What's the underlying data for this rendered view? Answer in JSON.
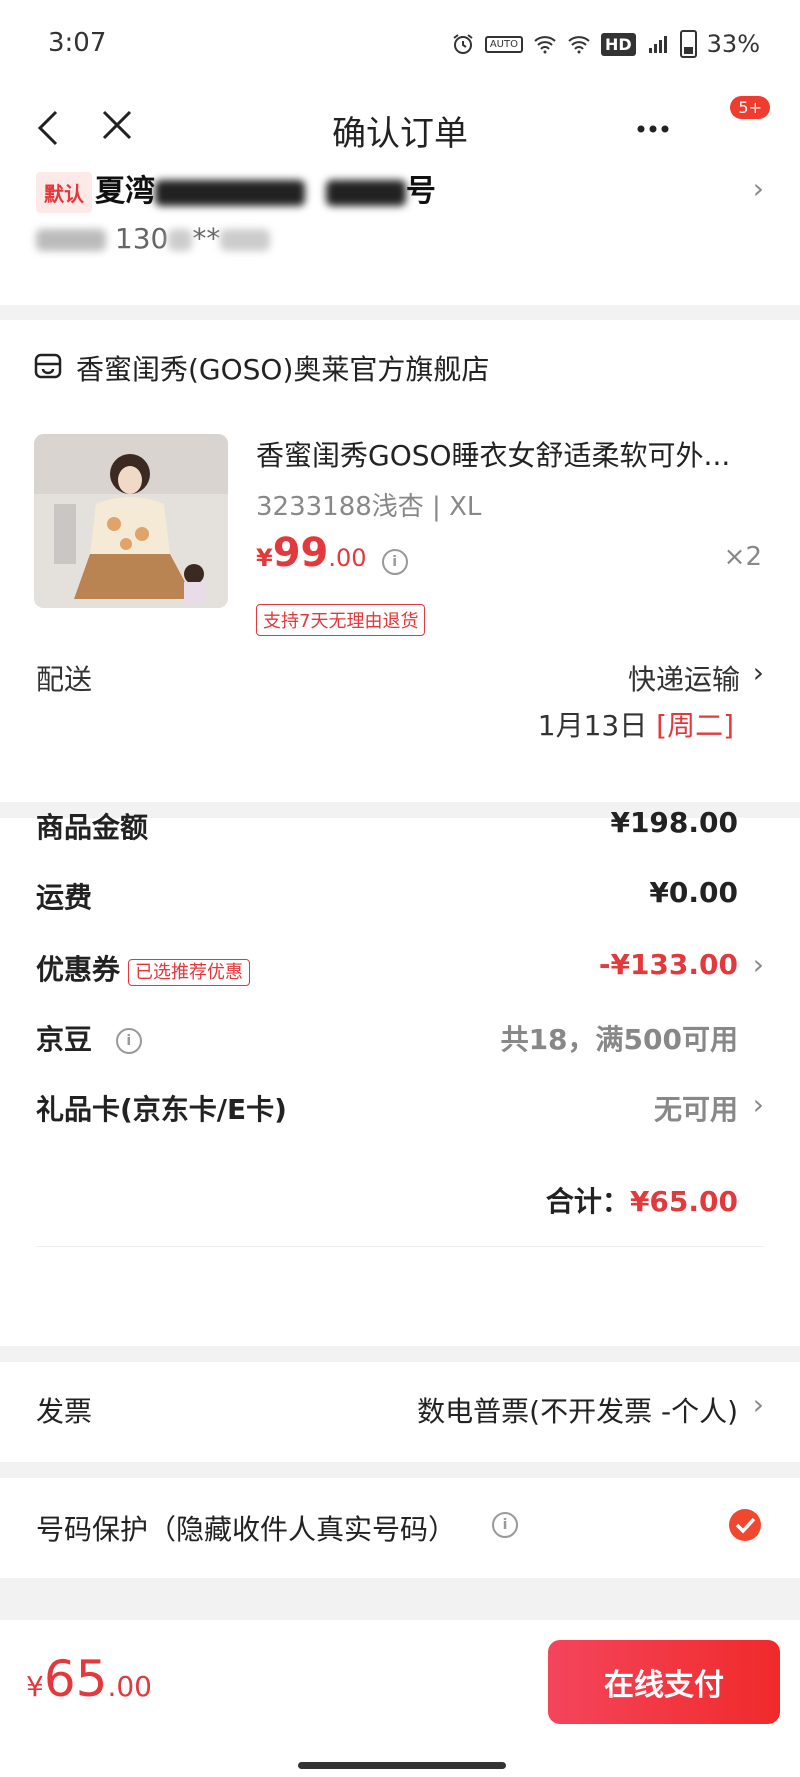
{
  "status_bar": {
    "time": "3:07",
    "battery": "33%",
    "hd": "HD",
    "auto": "AUTO"
  },
  "nav": {
    "title": "确认订单",
    "more_badge": "5+"
  },
  "address": {
    "default_tag": "默认",
    "name_line_prefix": "夏湾",
    "name_line_suffix": "号",
    "phone_partial": "130",
    "phone_masked": "**"
  },
  "shop": {
    "name": "香蜜闺秀(GOSO)奥莱官方旗舰店",
    "product": {
      "title": "香蜜闺秀GOSO睡衣女舒适柔软可外...",
      "spec": "3233188浅杏 | XL",
      "price_currency": "¥",
      "price_int": "99",
      "price_dec": ".00",
      "quantity": "×2",
      "return_tag": "支持7天无理由退货"
    },
    "delivery": {
      "label": "配送",
      "method": "快递运输",
      "date": "1月13日",
      "weekday": "[周二]"
    }
  },
  "summary": {
    "goods_amount": {
      "label": "商品金额",
      "value": "¥198.00"
    },
    "shipping": {
      "label": "运费",
      "value": "¥0.00"
    },
    "coupon": {
      "label": "优惠券",
      "tag": "已选推荐优惠",
      "value": "-¥133.00"
    },
    "jd_beans": {
      "label": "京豆",
      "value": "共18，满500可用"
    },
    "gift_card": {
      "label": "礼品卡(京东卡/E卡)",
      "value": "无可用"
    },
    "total": {
      "label": "合计：",
      "value": "¥65.00"
    }
  },
  "invoice": {
    "label": "发票",
    "value": "数电普票(不开发票 -个人)"
  },
  "number_protect": {
    "label": "号码保护（隐藏收件人真实号码）",
    "checked": true
  },
  "bottom": {
    "currency": "¥",
    "amount_int": "65",
    "amount_dec": ".00",
    "pay_label": "在线支付"
  },
  "colors": {
    "accent": "#e4393c",
    "button_start": "#f4455c",
    "button_end": "#f02a2a"
  }
}
